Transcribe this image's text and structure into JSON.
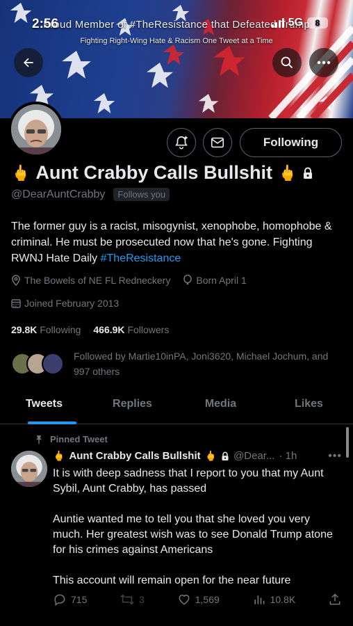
{
  "status_bar": {
    "time": "2:56",
    "network": "5G",
    "battery": "8"
  },
  "banner": {
    "caption": "Proud Member of #TheResistance that Defeated Trump",
    "subtitle": "Fighting Right-Wing Hate & Racism One Tweet at a Time"
  },
  "header_buttons": {
    "back_icon": "back-arrow-icon",
    "search_icon": "search-icon",
    "more_icon": "more-icon"
  },
  "profile": {
    "name": "Aunt Crabby Calls Bullshit",
    "name_emoji_left": "🖕",
    "name_emoji_right": "🖕",
    "handle": "@DearAuntCrabby",
    "follows_you": "Follows you",
    "following_label": "Following",
    "bio_text": "The former guy is a racist, misogynist, xenophobe, homophobe & criminal. He must be prosecuted now that he's gone. Fighting RWNJ Hate Daily ",
    "bio_hashtag": "#TheResistance",
    "location": "The Bowels of NE FL Redneckery",
    "birthday": "Born April 1",
    "joined": "Joined February 2013",
    "following_count": "29.8K",
    "following_label_text": "Following",
    "followers_count": "466.9K",
    "followers_label_text": "Followers",
    "followed_by": "Followed by Martie10inPA, Joni3620, Michael Jochum, and 997 others"
  },
  "tabs": [
    {
      "label": "Tweets"
    },
    {
      "label": "Replies"
    },
    {
      "label": "Media"
    },
    {
      "label": "Likes"
    }
  ],
  "pinned_tweet": {
    "pinned_label": "Pinned Tweet",
    "author_name": "Aunt Crabby Calls Bullshit",
    "handle": "@Dear...",
    "time": "· 1h",
    "paragraph_1": "It is with deep sadness that I report to you that my Aunt Sybil, Aunt Crabby, has passed",
    "paragraph_2": "Auntie wanted me to tell you that she loved you very much. Her greatest wish was to see Donald Trump atone for his crimes against Americans",
    "paragraph_3": "This account will remain open for the near future",
    "replies": "715",
    "retweets": "3",
    "likes": "1,569",
    "views": "10.8K"
  },
  "colors": {
    "accent": "#1d9bf0",
    "muted": "#71767b",
    "text": "#e7e9ea",
    "background": "#000000"
  }
}
